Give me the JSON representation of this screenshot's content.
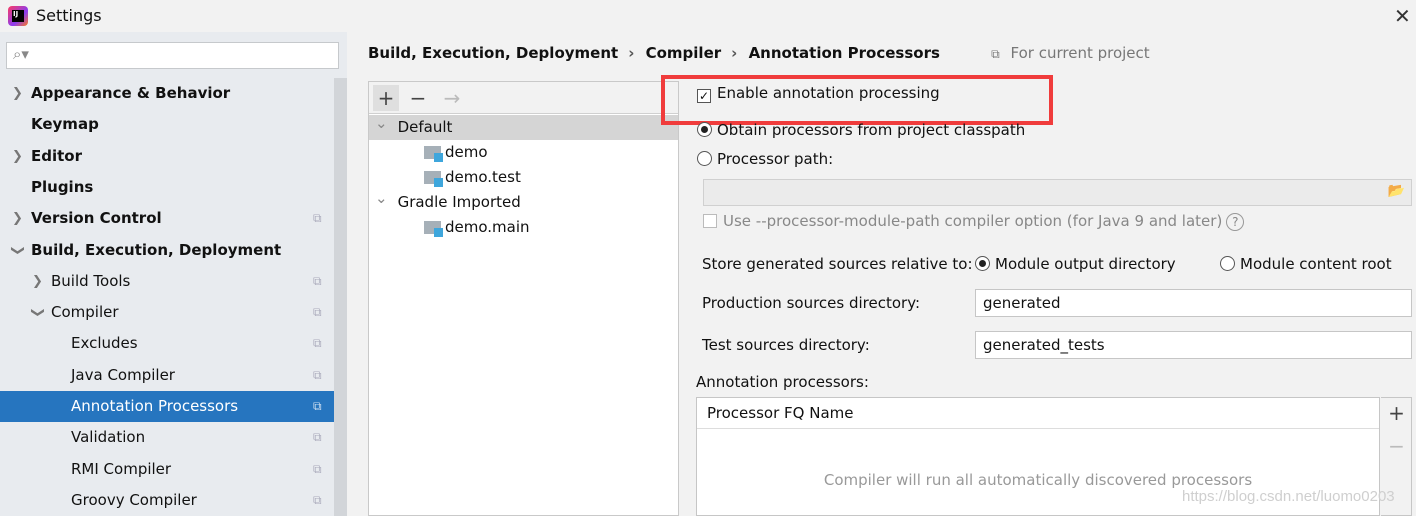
{
  "window": {
    "title": "Settings",
    "close_icon": "close-icon"
  },
  "sidebar": {
    "search_placeholder": "",
    "items": [
      {
        "label": "Appearance & Behavior",
        "bold": true,
        "arrow": "›"
      },
      {
        "label": "Keymap",
        "bold": true
      },
      {
        "label": "Editor",
        "bold": true,
        "arrow": "›"
      },
      {
        "label": "Plugins",
        "bold": true
      },
      {
        "label": "Version Control",
        "bold": true,
        "arrow": "›"
      },
      {
        "label": "Build, Execution, Deployment",
        "bold": true,
        "arrow": "⌄"
      },
      {
        "label": "Build Tools",
        "arrow": "›"
      },
      {
        "label": "Compiler",
        "arrow": "⌄"
      },
      {
        "label": "Excludes"
      },
      {
        "label": "Java Compiler"
      },
      {
        "label": "Annotation Processors",
        "selected": true
      },
      {
        "label": "Validation"
      },
      {
        "label": "RMI Compiler"
      },
      {
        "label": "Groovy Compiler"
      }
    ]
  },
  "breadcrumb": {
    "items": [
      "Build, Execution, Deployment",
      "Compiler",
      "Annotation Processors"
    ],
    "scope": "For current project"
  },
  "profiles": {
    "toolbar": {
      "add": "+",
      "remove": "−",
      "move": "→"
    },
    "rows": [
      {
        "label": "Default",
        "level": 0,
        "selected": true
      },
      {
        "label": "demo",
        "level": 1
      },
      {
        "label": "demo.test",
        "level": 1
      },
      {
        "label": "Gradle Imported",
        "level": 0
      },
      {
        "label": "demo.main",
        "level": 1
      }
    ]
  },
  "settings": {
    "enable_label": "Enable annotation processing",
    "enable_checked": true,
    "obtain_label": "Obtain processors from project classpath",
    "processor_path_label": "Processor path:",
    "processor_path_value": "",
    "module_path_label": "Use --processor-module-path compiler option (for Java 9 and later)",
    "help": "?",
    "store_label": "Store generated sources relative to:",
    "module_output": "Module output directory",
    "module_content": "Module content root",
    "prod_label": "Production sources directory:",
    "prod_value": "generated",
    "test_label": "Test sources directory:",
    "test_value": "generated_tests",
    "ap_label": "Annotation processors:",
    "ap_column": "Processor FQ Name",
    "ap_empty": "Compiler will run all automatically discovered processors",
    "ap_add": "+",
    "ap_remove": "−"
  },
  "watermark": "https://blog.csdn.net/luomo0203",
  "colors": {
    "selection": "#2675bf",
    "highlight_box": "#f03c3c"
  }
}
